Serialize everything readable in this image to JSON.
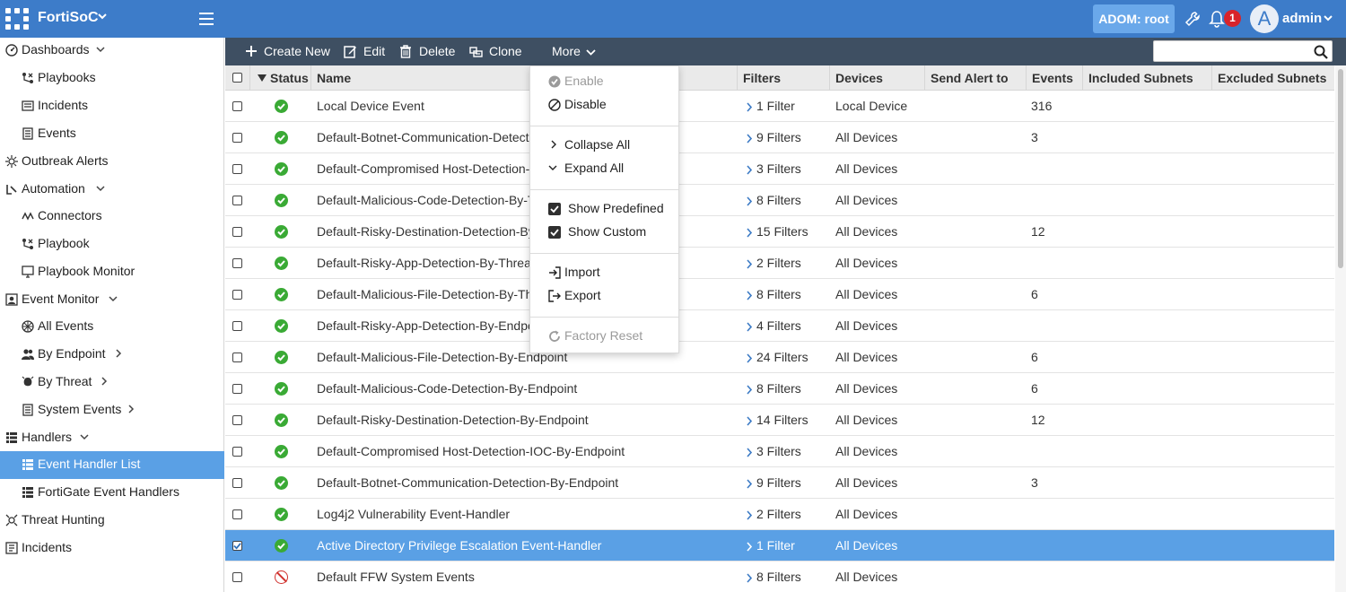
{
  "app": {
    "title": "FortiSoC"
  },
  "header": {
    "adom_label": "ADOM: root",
    "notification_count": "1",
    "avatar_initial": "A",
    "user_name": "admin"
  },
  "sidebar": {
    "items": [
      {
        "label": "Dashboards",
        "icon": "dashboard-icon",
        "expandable": "down"
      },
      {
        "label": "Playbooks",
        "icon": "playbook-icon"
      },
      {
        "label": "Incidents",
        "icon": "incident-icon"
      },
      {
        "label": "Events",
        "icon": "events-icon"
      },
      {
        "label": "Outbreak Alerts",
        "icon": "outbreak-icon"
      },
      {
        "label": "Automation",
        "icon": "automation-icon",
        "expandable": "down"
      },
      {
        "label": "Connectors",
        "icon": "connectors-icon"
      },
      {
        "label": "Playbook",
        "icon": "playbook-icon"
      },
      {
        "label": "Playbook Monitor",
        "icon": "monitor-icon"
      },
      {
        "label": "Event Monitor",
        "icon": "event-monitor-icon",
        "expandable": "down"
      },
      {
        "label": "All Events",
        "icon": "all-events-icon"
      },
      {
        "label": "By Endpoint",
        "icon": "endpoint-icon",
        "expandable": "right"
      },
      {
        "label": "By Threat",
        "icon": "threat-icon",
        "expandable": "right"
      },
      {
        "label": "System Events",
        "icon": "system-events-icon",
        "expandable": "right"
      },
      {
        "label": "Handlers",
        "icon": "handlers-icon",
        "expandable": "down"
      },
      {
        "label": "Event Handler List",
        "icon": "list-icon",
        "active": true
      },
      {
        "label": "FortiGate Event Handlers",
        "icon": "list-icon"
      },
      {
        "label": "Threat Hunting",
        "icon": "threat-hunting-icon"
      },
      {
        "label": "Incidents",
        "icon": "incidents-icon"
      }
    ]
  },
  "toolbar": {
    "create_new": "Create New",
    "edit": "Edit",
    "delete": "Delete",
    "clone": "Clone",
    "more": "More"
  },
  "search": {
    "placeholder": ""
  },
  "table": {
    "columns": [
      "Status",
      "Name",
      "Filters",
      "Devices",
      "Send Alert to",
      "Events",
      "Included Subnets",
      "Excluded Subnets"
    ],
    "rows": [
      {
        "status": "enabled",
        "name": "Local Device Event",
        "filters": "1 Filter",
        "devices": "Local Device",
        "send_alert_to": "",
        "events": "316"
      },
      {
        "status": "enabled",
        "name": "Default-Botnet-Communication-Detection-By-Threat",
        "filters": "9 Filters",
        "devices": "All Devices",
        "send_alert_to": "",
        "events": "3"
      },
      {
        "status": "enabled",
        "name": "Default-Compromised Host-Detection-IOC-By-Threat",
        "filters": "3 Filters",
        "devices": "All Devices",
        "send_alert_to": "",
        "events": ""
      },
      {
        "status": "enabled",
        "name": "Default-Malicious-Code-Detection-By-Threat",
        "filters": "8 Filters",
        "devices": "All Devices",
        "send_alert_to": "",
        "events": ""
      },
      {
        "status": "enabled",
        "name": "Default-Risky-Destination-Detection-By-Threat",
        "filters": "15 Filters",
        "devices": "All Devices",
        "send_alert_to": "",
        "events": "12"
      },
      {
        "status": "enabled",
        "name": "Default-Risky-App-Detection-By-Threat",
        "filters": "2 Filters",
        "devices": "All Devices",
        "send_alert_to": "",
        "events": ""
      },
      {
        "status": "enabled",
        "name": "Default-Malicious-File-Detection-By-Threat",
        "filters": "8 Filters",
        "devices": "All Devices",
        "send_alert_to": "",
        "events": "6"
      },
      {
        "status": "enabled",
        "name": "Default-Risky-App-Detection-By-Endpoint",
        "filters": "4 Filters",
        "devices": "All Devices",
        "send_alert_to": "",
        "events": ""
      },
      {
        "status": "enabled",
        "name": "Default-Malicious-File-Detection-By-Endpoint",
        "filters": "24 Filters",
        "devices": "All Devices",
        "send_alert_to": "",
        "events": "6"
      },
      {
        "status": "enabled",
        "name": "Default-Malicious-Code-Detection-By-Endpoint",
        "filters": "8 Filters",
        "devices": "All Devices",
        "send_alert_to": "",
        "events": "6"
      },
      {
        "status": "enabled",
        "name": "Default-Risky-Destination-Detection-By-Endpoint",
        "filters": "14 Filters",
        "devices": "All Devices",
        "send_alert_to": "",
        "events": "12"
      },
      {
        "status": "enabled",
        "name": "Default-Compromised Host-Detection-IOC-By-Endpoint",
        "filters": "3 Filters",
        "devices": "All Devices",
        "send_alert_to": "",
        "events": ""
      },
      {
        "status": "enabled",
        "name": "Default-Botnet-Communication-Detection-By-Endpoint",
        "filters": "9 Filters",
        "devices": "All Devices",
        "send_alert_to": "",
        "events": "3"
      },
      {
        "status": "enabled",
        "name": "Log4j2 Vulnerability Event-Handler",
        "filters": "2 Filters",
        "devices": "All Devices",
        "send_alert_to": "",
        "events": ""
      },
      {
        "status": "enabled",
        "name": "Active Directory Privilege Escalation Event-Handler",
        "filters": "1 Filter",
        "devices": "All Devices",
        "send_alert_to": "",
        "events": "",
        "selected": true
      },
      {
        "status": "disabled",
        "name": "Default FFW System Events",
        "filters": "8 Filters",
        "devices": "All Devices",
        "send_alert_to": "",
        "events": ""
      }
    ]
  },
  "more_menu": {
    "enable": "Enable",
    "disable": "Disable",
    "collapse_all": "Collapse All",
    "expand_all": "Expand All",
    "show_predefined": "Show Predefined",
    "show_custom": "Show Custom",
    "show_predefined_checked": true,
    "show_custom_checked": true,
    "import": "Import",
    "export": "Export",
    "factory_reset": "Factory Reset"
  },
  "colors": {
    "header_blue": "#3d7cc9",
    "toolbar_dark": "#3e4f62",
    "selection_blue": "#5aa0e5",
    "status_green": "#3aaa35",
    "status_red": "#d0312d"
  }
}
